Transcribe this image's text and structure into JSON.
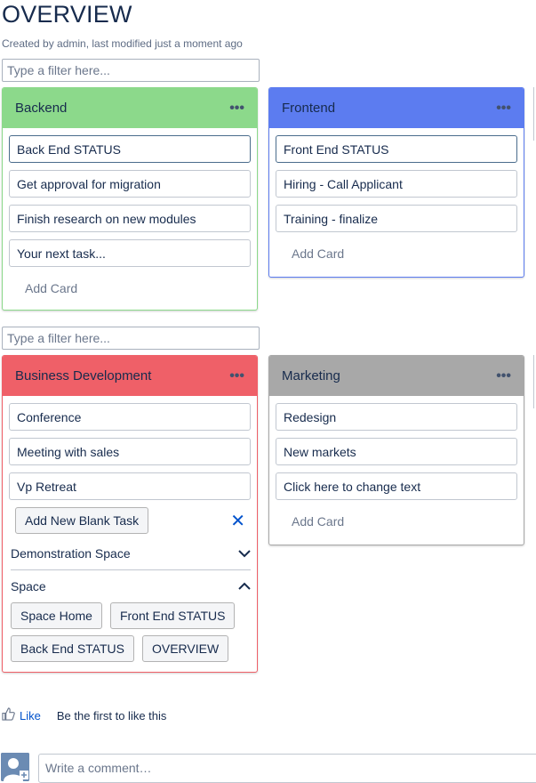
{
  "page": {
    "title": "OVERVIEW",
    "byline": "Created by admin, last modified just a moment ago"
  },
  "filters": {
    "placeholder": "Type a filter here..."
  },
  "boards": {
    "backend": {
      "title": "Backend",
      "color": "#8cd98b",
      "border": "#8cd98b",
      "cards": [
        "Back End STATUS",
        "Get approval for migration",
        "Finish research on new modules",
        "Your next task..."
      ],
      "add_card": "Add Card"
    },
    "frontend": {
      "title": "Frontend",
      "color": "#5c7cf0",
      "border": "#5c7cf0",
      "cards": [
        "Front End STATUS",
        "Hiring - Call Applicant",
        "Training - finalize"
      ],
      "add_card": "Add Card"
    },
    "bizdev": {
      "title": "Business Development",
      "color": "#ef6068",
      "border": "#ef6068",
      "cards": [
        "Conference",
        "Meeting with sales",
        "Vp Retreat"
      ],
      "add_blank_task": "Add New Blank Task",
      "close_icon": "close-icon",
      "sections": [
        {
          "label": "Demonstration Space",
          "expanded": false
        },
        {
          "label": "Space",
          "expanded": true
        }
      ],
      "space_links": [
        "Space Home",
        "Front End STATUS",
        "Back End STATUS",
        "OVERVIEW"
      ]
    },
    "marketing": {
      "title": "Marketing",
      "color": "#a8a8a8",
      "border": "#a8a8a8",
      "cards": [
        "Redesign",
        "New markets",
        "Click here to change text"
      ],
      "add_card": "Add Card"
    }
  },
  "footer": {
    "like_label": "Like",
    "like_text": "Be the first to like this",
    "comment_placeholder": "Write a comment…"
  },
  "icons": {
    "more": "more-icon",
    "chevron_down": "chevron-down-icon",
    "chevron_up": "chevron-up-icon",
    "thumbs_up": "thumbs-up-icon",
    "avatar": "avatar-icon"
  }
}
